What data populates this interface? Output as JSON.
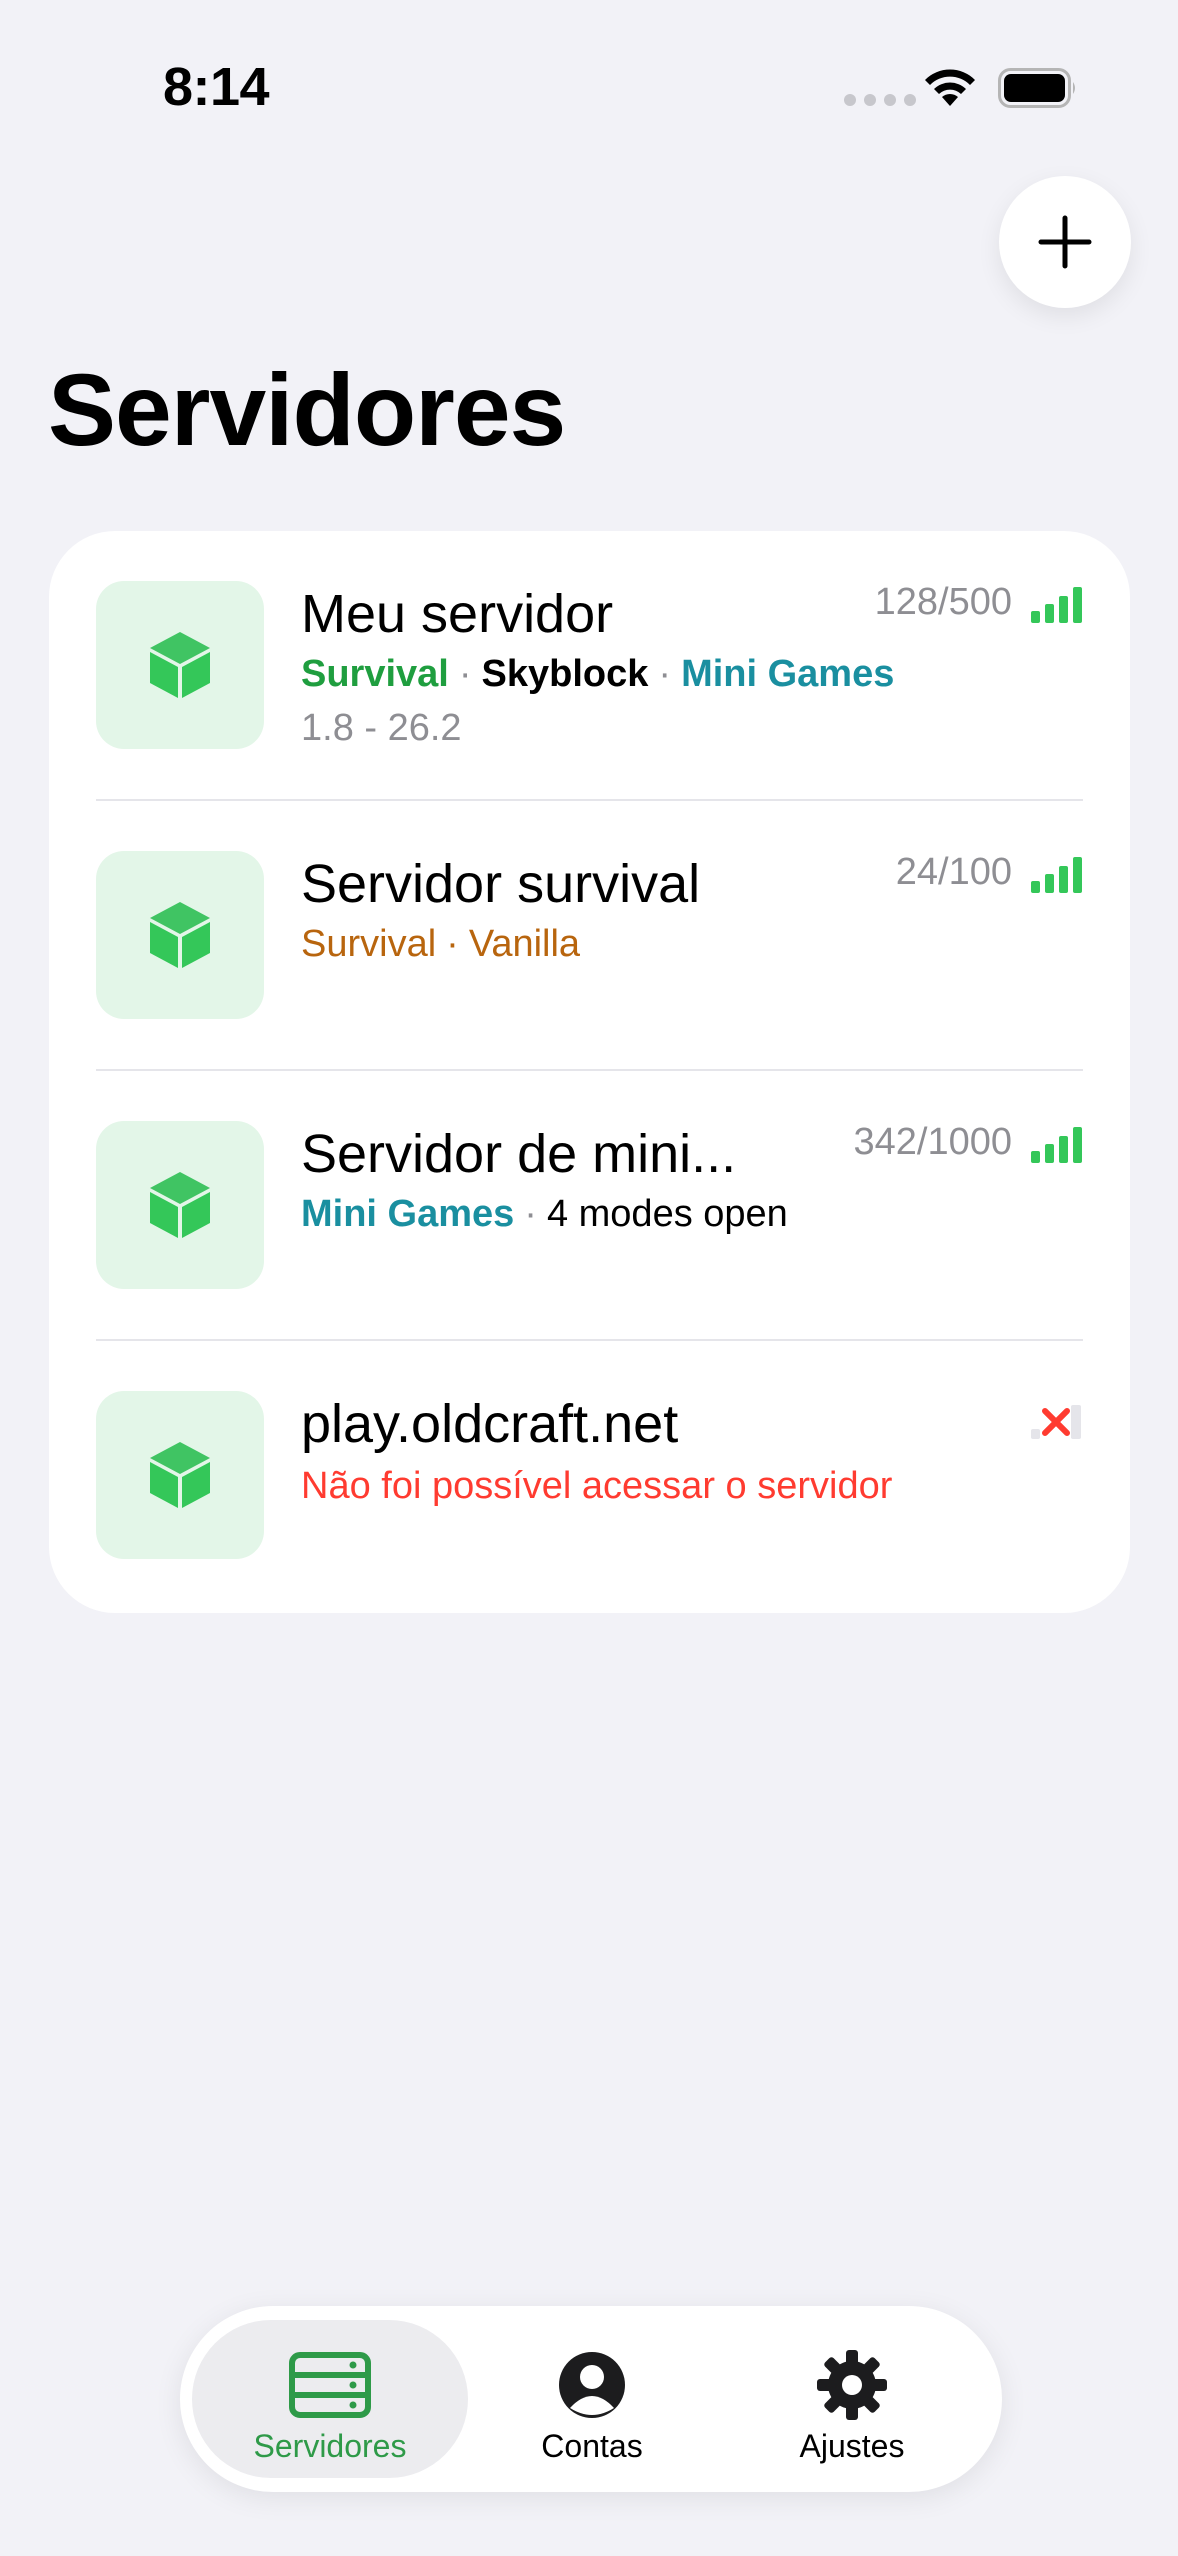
{
  "status": {
    "time": "8:14"
  },
  "page": {
    "title": "Servidores"
  },
  "servers": [
    {
      "name": "Meu servidor",
      "players": "128/500",
      "tags": [
        {
          "text": "Survival",
          "color": "#1f9e3f",
          "weight": "600"
        },
        {
          "text": "Skyblock",
          "color": "#000000",
          "weight": "600"
        },
        {
          "text": "Mini Games",
          "color": "#1a8fa0",
          "weight": "600"
        }
      ],
      "version": "1.8 - 26.2"
    },
    {
      "name": "Servidor survival",
      "players": "24/100",
      "tags": [
        {
          "text": "Survival",
          "color": "#b8650e",
          "weight": "400"
        },
        {
          "text": "Vanilla",
          "color": "#b8650e",
          "weight": "400"
        }
      ]
    },
    {
      "name": "Servidor de mini...",
      "players": "342/1000",
      "tags": [
        {
          "text": "Mini Games",
          "color": "#1a8fa0",
          "weight": "600"
        },
        {
          "text": "4 modes open",
          "color": "#000000",
          "weight": "400"
        }
      ]
    },
    {
      "name": "play.oldcraft.net",
      "error": "Não foi possível acessar o servidor"
    }
  ],
  "tabbar": {
    "tabs": [
      {
        "label": "Servidores",
        "icon": "server-icon",
        "active": true
      },
      {
        "label": "Contas",
        "icon": "account-icon",
        "active": false
      },
      {
        "label": "Ajustes",
        "icon": "gear-icon",
        "active": false
      }
    ]
  },
  "colors": {
    "accent_green": "#34c759",
    "tab_active": "#2e9a48",
    "error_red": "#ff3b30"
  }
}
